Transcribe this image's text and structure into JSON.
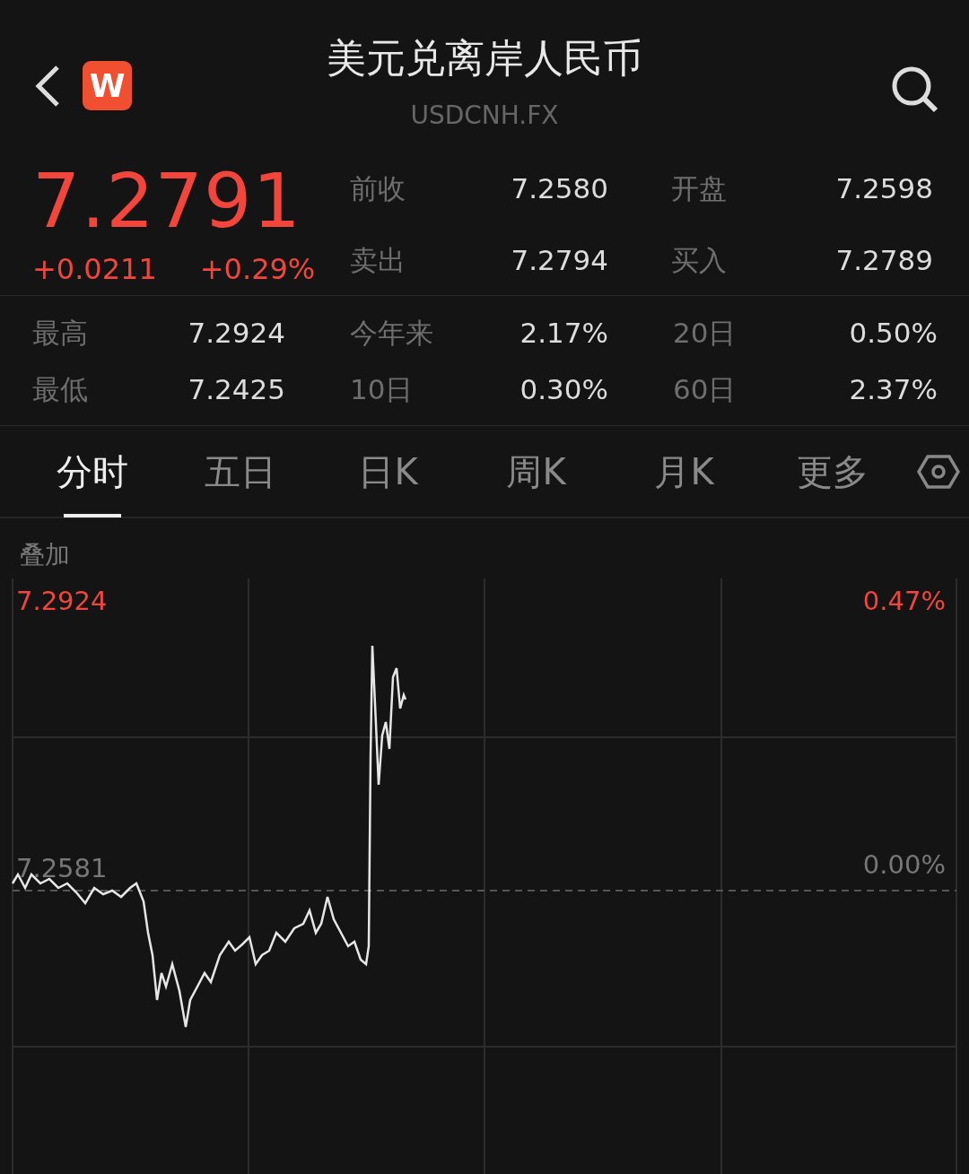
{
  "header": {
    "logo": "W",
    "title": "美元兑离岸人民币",
    "subtitle": "USDCNH.FX"
  },
  "quote": {
    "price": "7.2791",
    "change": "+0.0211",
    "change_pct": "+0.29%"
  },
  "top_stats": [
    {
      "label": "前收",
      "value": "7.2580"
    },
    {
      "label": "开盘",
      "value": "7.2598"
    },
    {
      "label": "卖出",
      "value": "7.2794"
    },
    {
      "label": "买入",
      "value": "7.2789"
    }
  ],
  "stats": [
    {
      "label": "最高",
      "value": "7.2924"
    },
    {
      "label": "今年来",
      "value": "2.17%"
    },
    {
      "label": "20日",
      "value": "0.50%"
    },
    {
      "label": "最低",
      "value": "7.2425"
    },
    {
      "label": "10日",
      "value": "0.30%"
    },
    {
      "label": "60日",
      "value": "2.37%"
    }
  ],
  "tabs": [
    {
      "label": "分时",
      "selected": true
    },
    {
      "label": "五日",
      "selected": false
    },
    {
      "label": "日K",
      "selected": false
    },
    {
      "label": "周K",
      "selected": false
    },
    {
      "label": "月K",
      "selected": false
    },
    {
      "label": "更多",
      "selected": false
    }
  ],
  "chart": {
    "overlay_label": "叠加",
    "high_price": "7.2924",
    "high_pct": "0.47%",
    "base_price": "7.2581",
    "base_pct": "0.00%"
  }
}
